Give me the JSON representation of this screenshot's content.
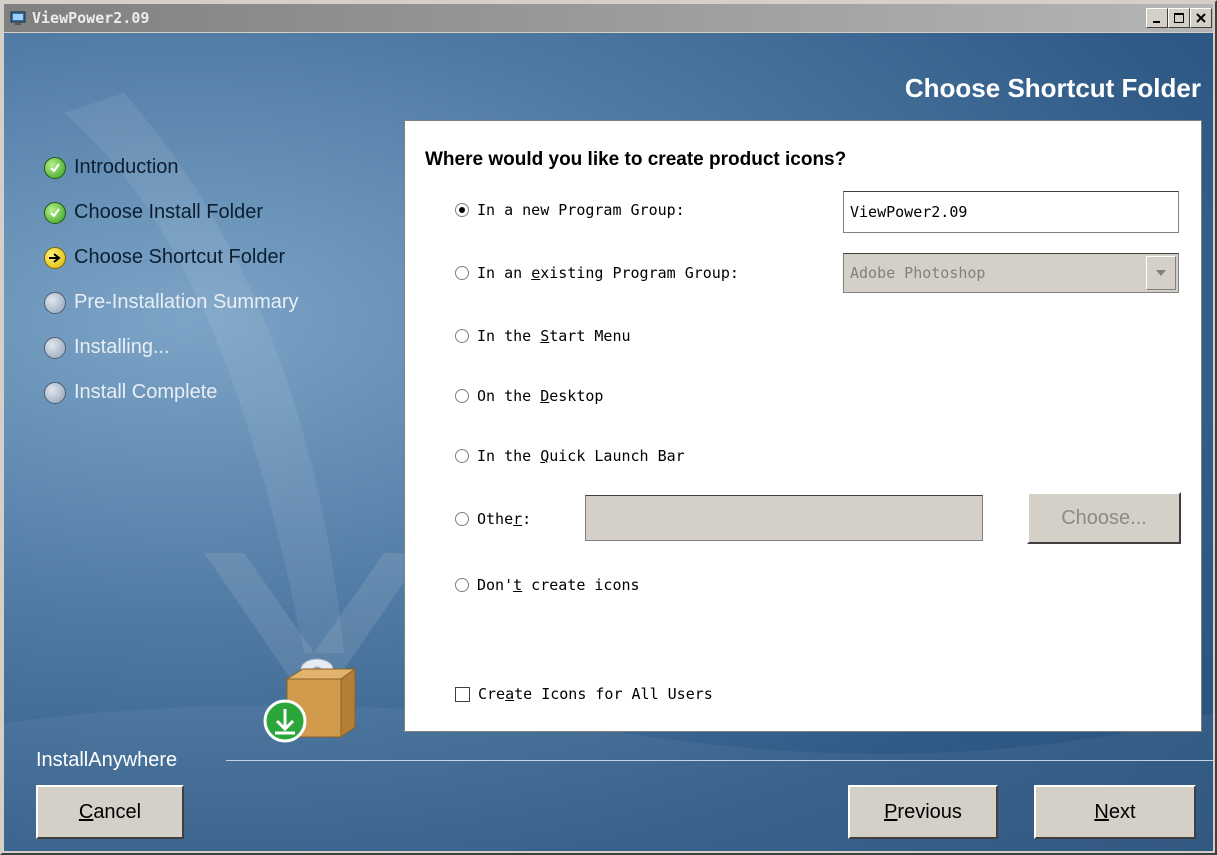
{
  "window": {
    "title": "ViewPower2.09",
    "controls": [
      "minimize",
      "maximize",
      "close"
    ]
  },
  "header": {
    "title": "Choose Shortcut Folder"
  },
  "steps": [
    {
      "label": "Introduction",
      "status": "done"
    },
    {
      "label": "Choose Install Folder",
      "status": "done"
    },
    {
      "label": "Choose Shortcut Folder",
      "status": "current"
    },
    {
      "label": "Pre-Installation Summary",
      "status": "pending"
    },
    {
      "label": "Installing...",
      "status": "pending"
    },
    {
      "label": "Install Complete",
      "status": "pending"
    }
  ],
  "form": {
    "question": "Where would you like to create product icons?",
    "options": {
      "new_group": {
        "label": "In a new Program Group:",
        "selected": true
      },
      "existing_group": {
        "pre": "In an ",
        "key": "e",
        "post": "xisting Program Group:",
        "selected": false
      },
      "start_menu": {
        "pre": "In the ",
        "key": "S",
        "post": "tart Menu",
        "selected": false
      },
      "desktop": {
        "pre": "On the ",
        "key": "D",
        "post": "esktop",
        "selected": false
      },
      "quick_launch": {
        "pre": "In the ",
        "key": "Q",
        "post": "uick Launch Bar",
        "selected": false
      },
      "other": {
        "pre": "Othe",
        "key": "r",
        "post": ":",
        "selected": false
      },
      "dont_create": {
        "pre": "Don'",
        "key": "t",
        "post": " create icons",
        "selected": false
      }
    },
    "new_group_value": "ViewPower2.09",
    "existing_group_value": "Adobe Photoshop",
    "other_value": "",
    "choose_label": "Choose...",
    "all_users": {
      "pre": "Cre",
      "key": "a",
      "post": "te Icons for All Users",
      "checked": false
    }
  },
  "footer": {
    "brand": "InstallAnywhere",
    "cancel": {
      "key": "C",
      "rest": "ancel"
    },
    "previous": {
      "key": "P",
      "rest": "revious"
    },
    "next": {
      "key": "N",
      "rest": "ext"
    }
  },
  "colors": {
    "background_blue": "#2f5a86",
    "panel": "#ffffff",
    "title_bar": "#808080",
    "step_done": "#2e9d1e",
    "step_current": "#d6b400",
    "step_pending": "#8fa0b5"
  },
  "icons": {
    "app": "app-icon",
    "step_done": "check-circle-icon",
    "step_current": "arrow-circle-icon",
    "step_pending": "gray-circle-icon",
    "installer": "box-with-cd-icon"
  }
}
